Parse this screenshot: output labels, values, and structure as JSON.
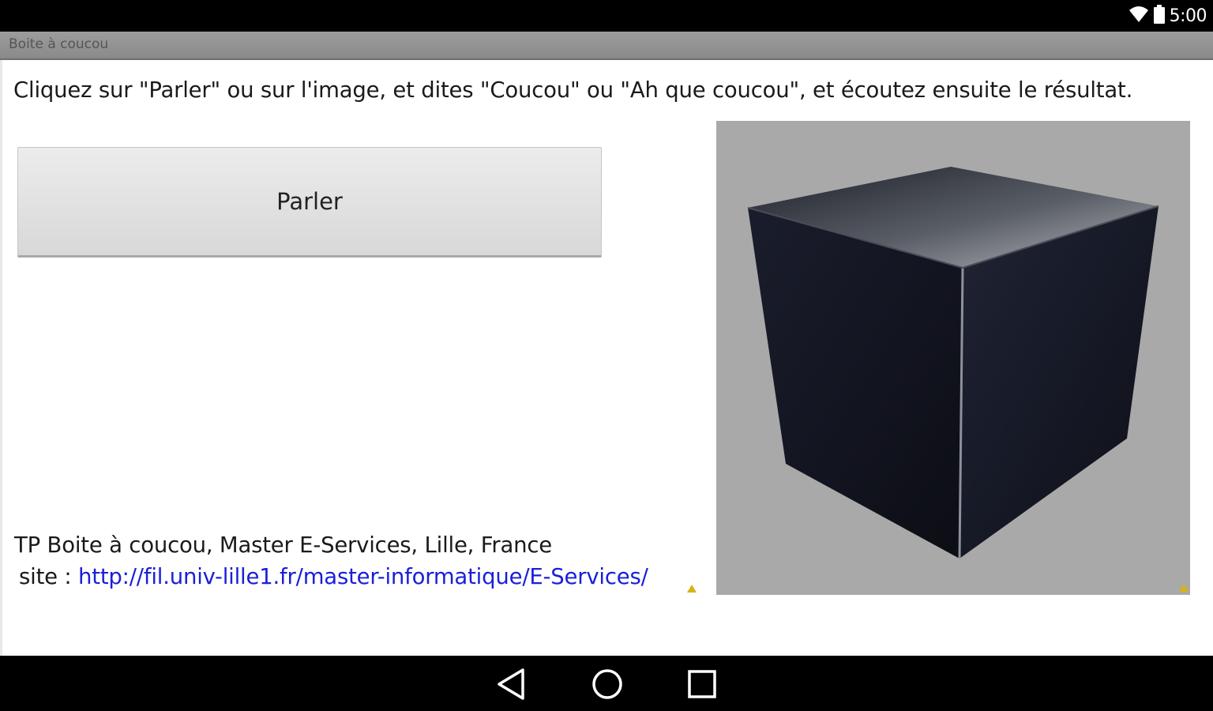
{
  "status_bar": {
    "time": "5:00",
    "icons": [
      "wifi-icon",
      "battery-icon"
    ]
  },
  "app": {
    "title": "Boite à coucou"
  },
  "main": {
    "instructions": "Cliquez sur \"Parler\" ou sur l'image, et dites \"Coucou\" ou \"Ah que coucou\", et écoutez ensuite le résultat.",
    "speak_button_label": "Parler",
    "image_subject": "black-cube",
    "footer_line1": "TP Boite à coucou, Master E-Services, Lille, France",
    "footer_site_label": "site : ",
    "footer_site_url": "http://fil.univ-lille1.fr/master-informatique/E-Services/"
  },
  "nav_bar": {
    "buttons": [
      "back-icon",
      "home-icon",
      "recents-icon"
    ]
  },
  "colors": {
    "status_bar": "#000000",
    "title_bar": "#929292",
    "link": "#1a1fd8",
    "image_background": "#a9a9a9"
  }
}
